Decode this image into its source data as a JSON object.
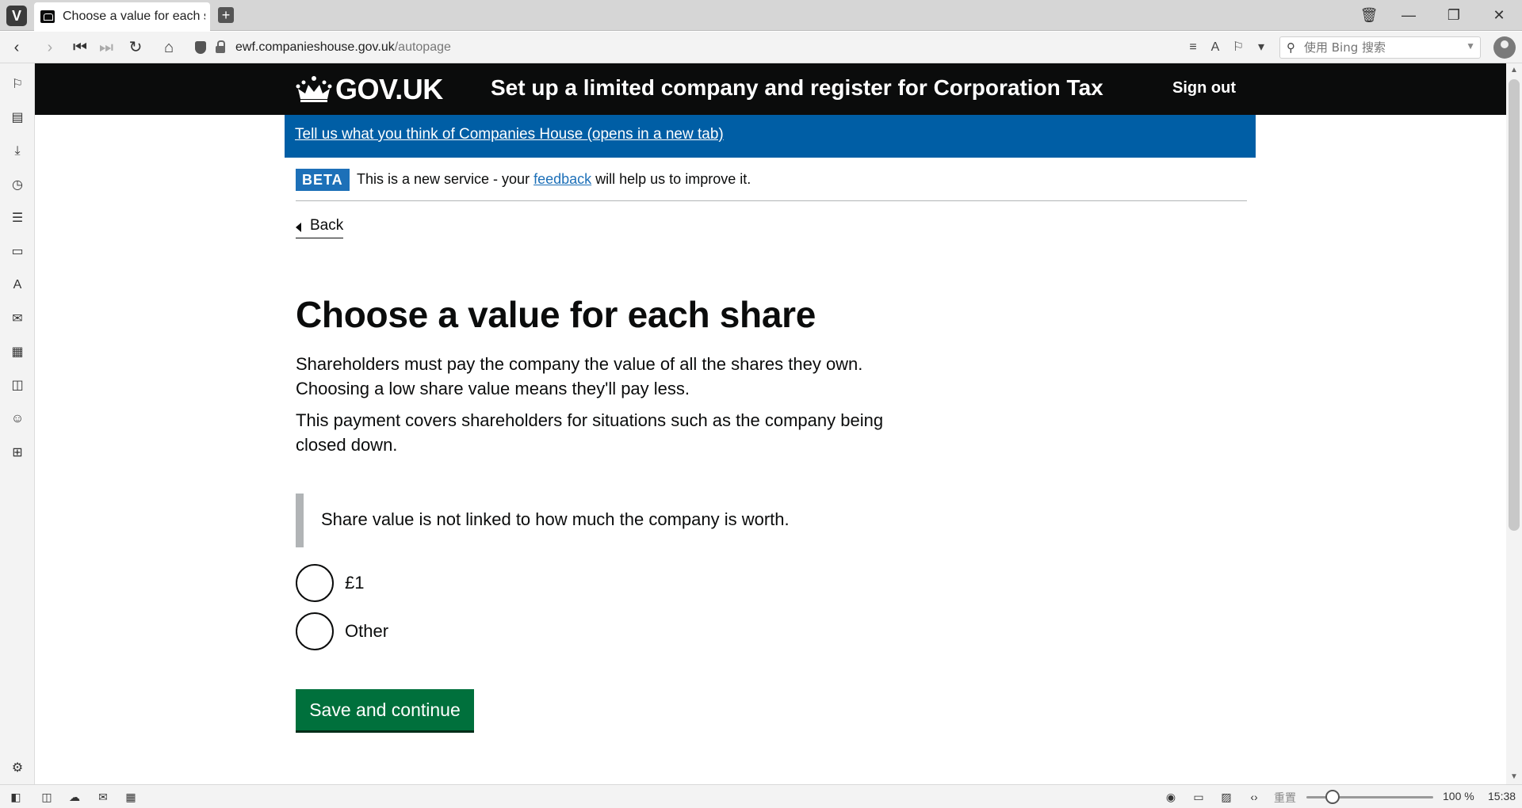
{
  "browser": {
    "tab_title": "Choose a value for each share",
    "url_domain": "ewf.companieshouse.gov.uk",
    "url_path": "/autopage",
    "search_placeholder": "使用 Bing 搜索",
    "zoom_label": "重置",
    "zoom_percent": "100 %",
    "zoom_level": 0.15,
    "clock": "15:38"
  },
  "header": {
    "logo_text": "GOV.UK",
    "service_name": "Set up a limited company and register for Corporation Tax",
    "sign_out": "Sign out"
  },
  "feedback_banner": {
    "link_text": "Tell us what you think of Companies House (opens in a new tab)"
  },
  "phase_banner": {
    "tag": "BETA",
    "text_before": "This is a new service - your ",
    "link_text": "feedback",
    "text_after": " will help us to improve it."
  },
  "back_link": "Back",
  "main": {
    "heading": "Choose a value for each share",
    "para1": "Shareholders must pay the company the value of all the shares they own. Choosing a low share value means they'll pay less.",
    "para2": "This payment covers shareholders for situations such as the company being closed down.",
    "inset": "Share value is not linked to how much the company is worth.",
    "options": [
      {
        "label": "£1",
        "selected": false
      },
      {
        "label": "Other",
        "selected": false
      }
    ],
    "submit_label": "Save and continue"
  },
  "colors": {
    "header_bg": "#0b0c0c",
    "banner_blue": "#005ea5",
    "tag_blue": "#1d70b8",
    "button_green": "#00703c",
    "inset_border": "#b1b4b6"
  }
}
